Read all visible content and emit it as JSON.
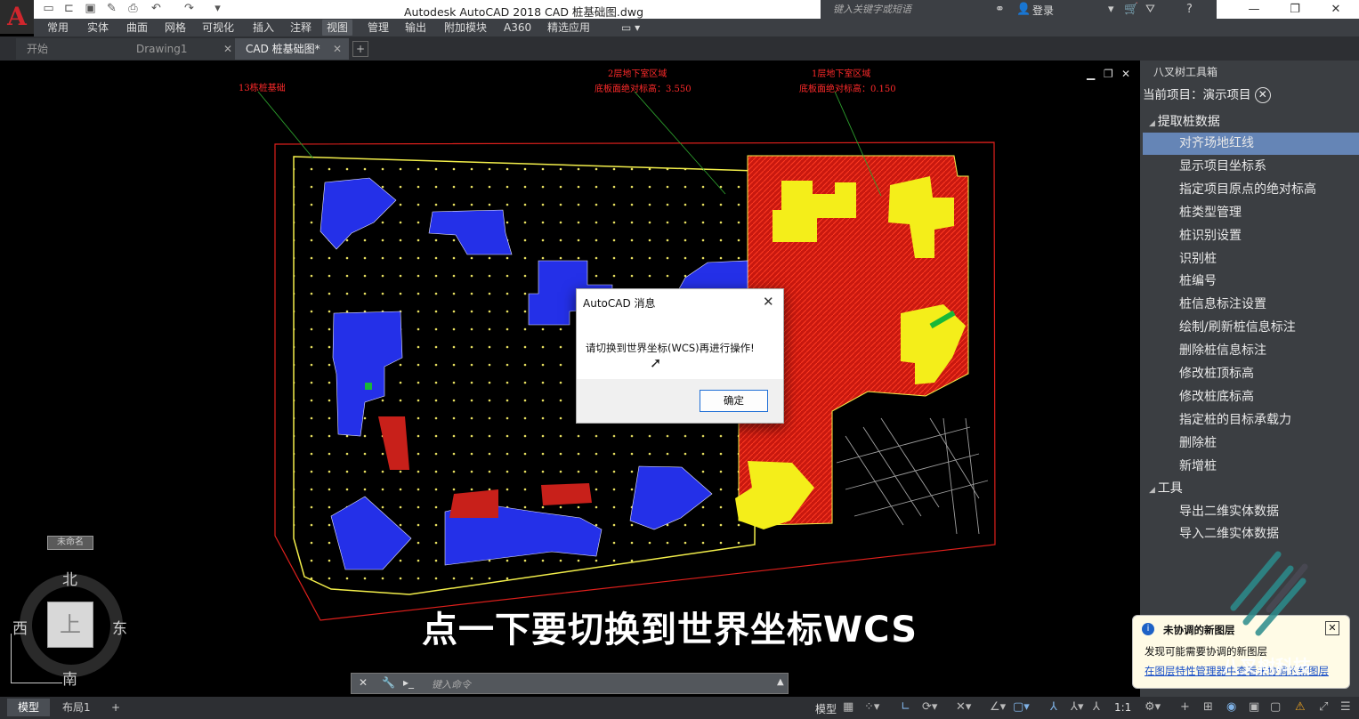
{
  "title_bar": {
    "window_title": "Autodesk AutoCAD 2018    CAD 桩基础图.dwg",
    "search_placeholder": "键入关键字或短语",
    "login_label": "登录"
  },
  "ribbon_tabs": [
    "常用",
    "实体",
    "曲面",
    "网格",
    "可视化",
    "插入",
    "注释",
    "视图",
    "管理",
    "输出",
    "附加模块",
    "A360",
    "精选应用"
  ],
  "active_ribbon_tab": "视图",
  "file_tabs": [
    {
      "label": "开始",
      "active": false
    },
    {
      "label": "Drawing1",
      "active": false
    },
    {
      "label": "CAD 桩基础图*",
      "active": true
    }
  ],
  "drawing_annotations": {
    "left": "13栋桩基础",
    "middle_line1": "2层地下室区域",
    "middle_line2": "底板面绝对标高：3.550",
    "right_line1": "1层地下室区域",
    "right_line2": "底板面绝对标高：0.150"
  },
  "dialog": {
    "title": "AutoCAD 消息",
    "message": "请切换到世界坐标(WCS)再进行操作!",
    "ok_label": "确定"
  },
  "subtitle": "点一下要切换到世界坐标WCS",
  "compass": {
    "north": "北",
    "south": "南",
    "east": "东",
    "west": "西",
    "face": "上",
    "wcs_label": "未命名"
  },
  "command_line": {
    "placeholder": "键入命令"
  },
  "palette": {
    "title": "八叉树工具箱",
    "project_label": "当前项目：演示项目",
    "groups": [
      {
        "label": "提取桩数据",
        "items": [
          "对齐场地红线",
          "显示项目坐标系",
          "指定项目原点的绝对标高",
          "桩类型管理",
          "桩识别设置",
          "识别桩",
          "桩编号",
          "桩信息标注设置",
          "绘制/刷新桩信息标注",
          "删除桩信息标注",
          "修改桩顶标高",
          "修改桩底标高",
          "指定桩的目标承载力",
          "删除桩",
          "新增桩"
        ]
      },
      {
        "label": "工具",
        "items": [
          "导出二维实体数据",
          "导入二维实体数据"
        ]
      }
    ],
    "selected_item": "对齐场地红线"
  },
  "notification": {
    "title": "未协调的新图层",
    "body": "发现可能需要协调的新图层",
    "link": "在图层特性管理器中查看未协调的新图层"
  },
  "watermark": "八叉树科技",
  "status_bar": {
    "layout_tabs": [
      "模型",
      "布局1"
    ],
    "model_label": "模型",
    "scale": "1:1"
  }
}
